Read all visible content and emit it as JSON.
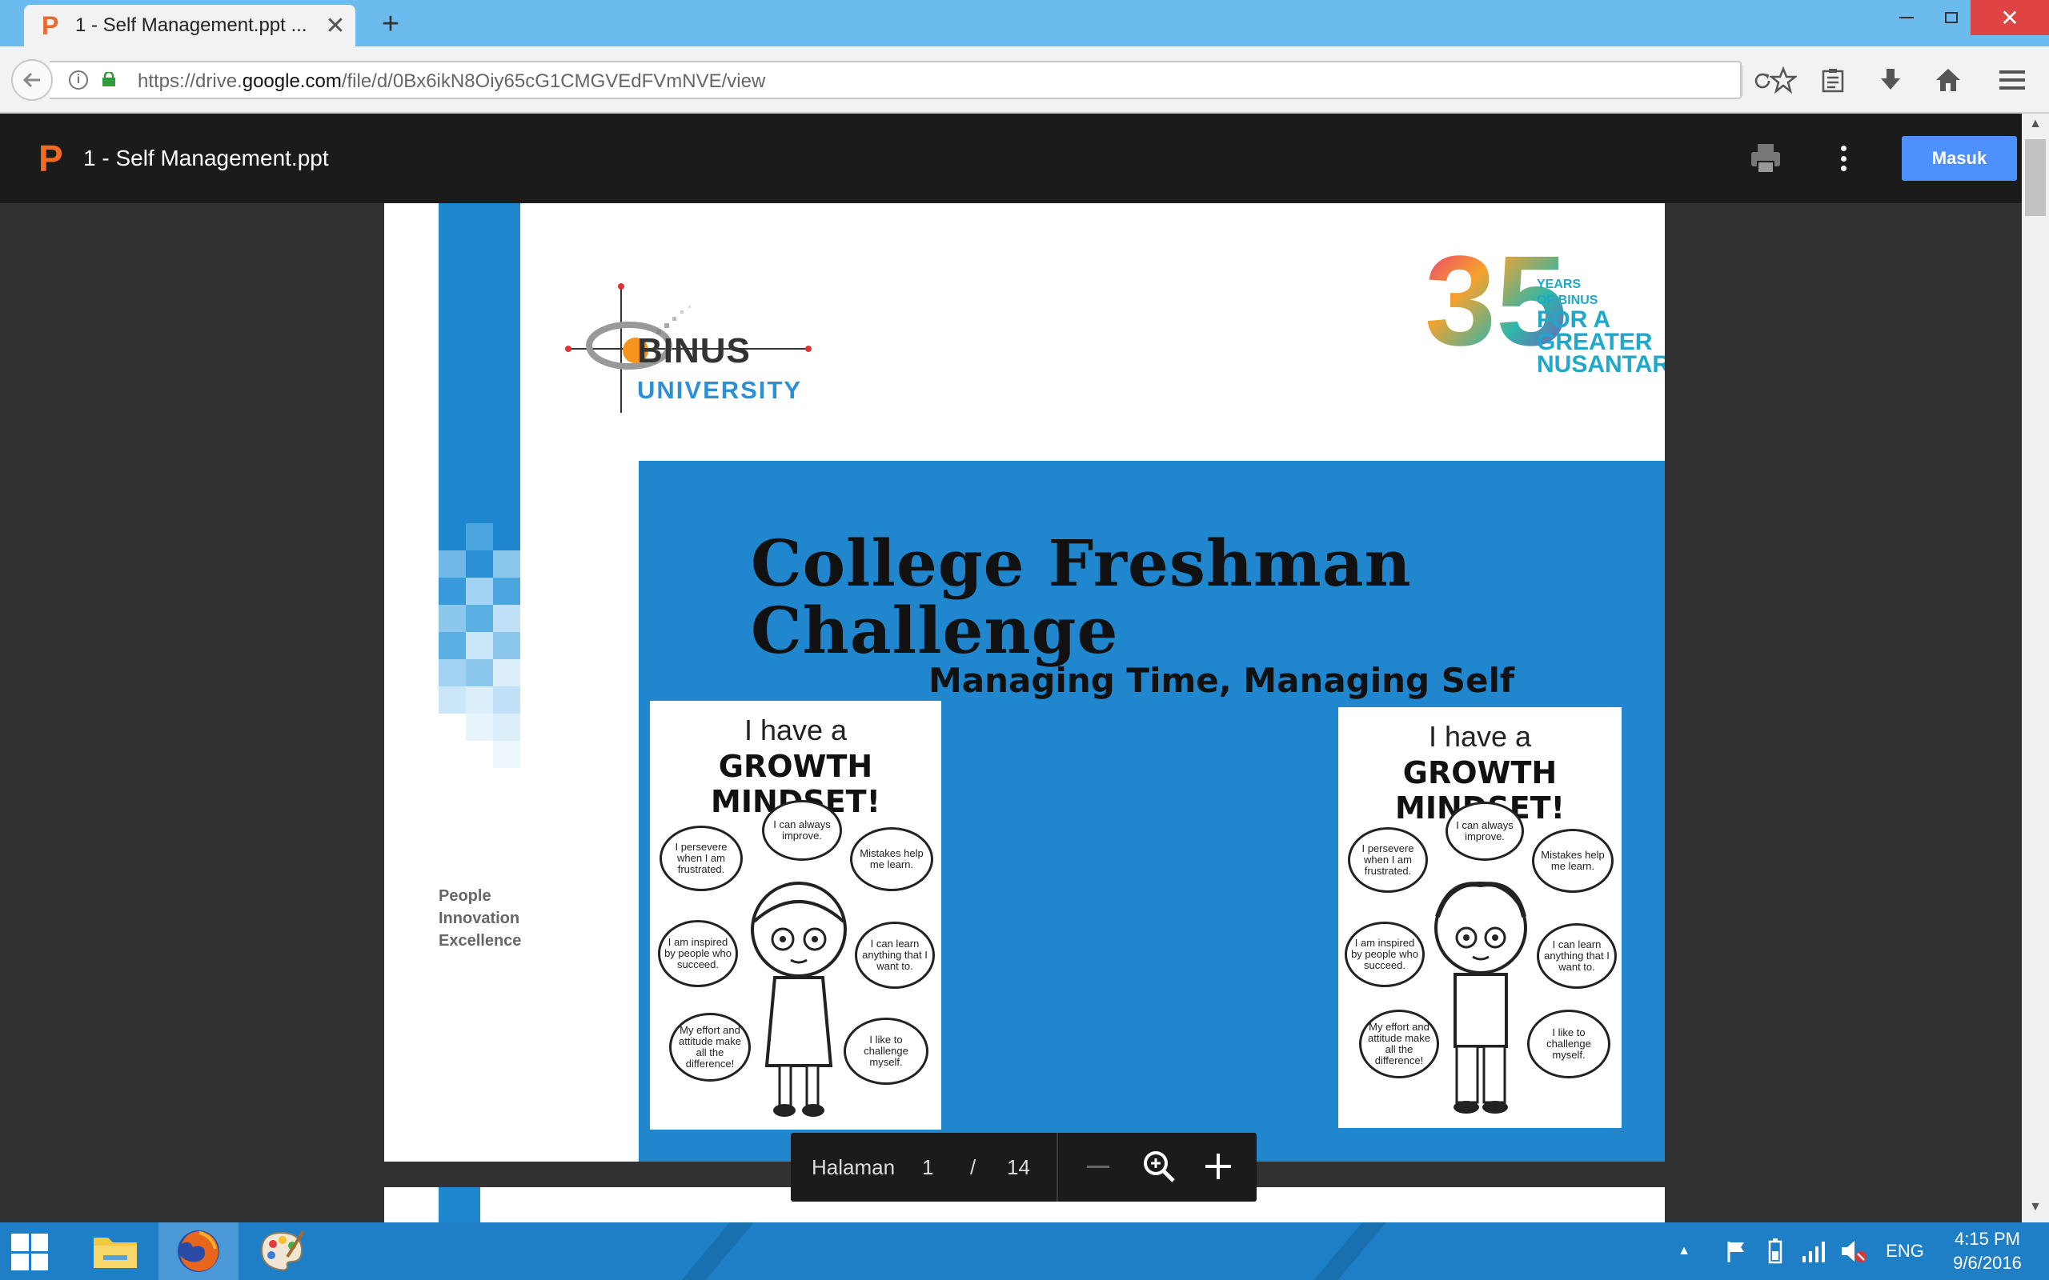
{
  "browser": {
    "tab_title": "1 - Self Management.ppt ...",
    "tab_favicon": "P",
    "url_prefix": "https://drive.",
    "url_domain": "google.com",
    "url_path": "/file/d/0Bx6ikN8Oiy65cG1CMGVEdFVmNVE/view",
    "close_glyph": "✕",
    "newtab_glyph": "+"
  },
  "viewer": {
    "app_icon": "P",
    "file_title": "1 - Self Management.ppt",
    "signin_label": "Masuk"
  },
  "slide": {
    "university_name": "BINUS",
    "university_sub": "UNIVERSITY",
    "anniversary_number": "35",
    "anniversary_lines": [
      "YEARS",
      "OF BINUS",
      "FOR A",
      "GREATER",
      "NUSANTARA"
    ],
    "tagline": [
      "People",
      "Innovation",
      "Excellence"
    ],
    "title_line1": "College Freshman",
    "title_line2": "Challenge",
    "subtitle": "Managing Time, Managing Self",
    "poster": {
      "line1": "I have a",
      "line2": "GROWTH MINDSET!",
      "bubbles": [
        "I persevere when I am frustrated.",
        "I can always improve.",
        "Mistakes help me learn.",
        "I am inspired by people who succeed.",
        "I can learn anything that I want to.",
        "My effort and attitude make all the difference!",
        "I like to challenge myself."
      ]
    }
  },
  "pagebar": {
    "label": "Halaman",
    "current": "1",
    "separator": "/",
    "total": "14"
  },
  "taskbar": {
    "language": "ENG",
    "time": "4:15 PM",
    "date": "9/6/2016"
  },
  "colors": {
    "titlebar": "#6cbbee",
    "slide_blue": "#2087cf",
    "signin_blue": "#4d90fe",
    "taskbar": "#1f7fc6",
    "ppt_orange": "#f26b21"
  }
}
